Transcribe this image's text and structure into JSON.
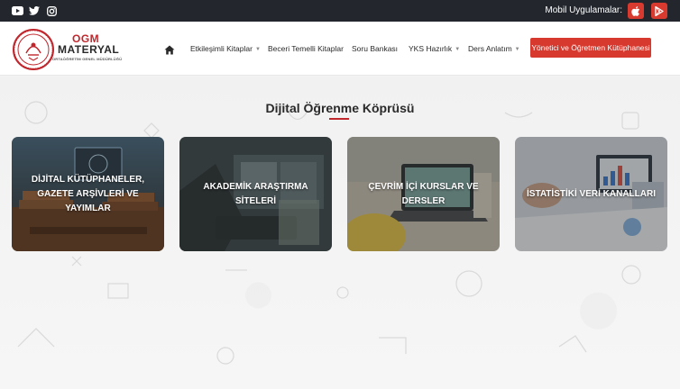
{
  "topbar": {
    "social": [
      "youtube-icon",
      "twitter-icon",
      "instagram-icon"
    ],
    "mobile_label": "Mobil Uygulamalar:",
    "apps": [
      "apple-icon",
      "google-play-icon"
    ]
  },
  "logo": {
    "line1": "OGM",
    "line2": "MATERYAL",
    "subtitle": "ORTAÖĞRETİM GENEL MÜDÜRLÜĞÜ"
  },
  "nav": {
    "home_icon": "home-icon",
    "items": [
      {
        "label": "Etkileşimli Kitaplar",
        "dropdown": true
      },
      {
        "label": "Beceri Temelli Kitaplar",
        "dropdown": false
      },
      {
        "label": "Soru Bankası",
        "dropdown": false
      },
      {
        "label": "YKS Hazırlık",
        "dropdown": true
      },
      {
        "label": "Ders Anlatım",
        "dropdown": true
      }
    ],
    "cta": "Yönetici ve Öğretmen Kütüphanesi"
  },
  "section": {
    "title": "Dijital Öğrenme Köprüsü"
  },
  "cards": [
    {
      "label": "DİJİTAL KÜTÜPHANELER, GAZETE ARŞİVLERİ VE YAYIMLAR"
    },
    {
      "label": "AKADEMİK ARAŞTIRMA SİTELERİ"
    },
    {
      "label": "ÇEVRİM İÇİ KURSLAR VE DERSLER"
    },
    {
      "label": "İSTATİSTİKİ VERİ KANALLARI"
    }
  ],
  "colors": {
    "topbar": "#23272d",
    "brand_red": "#d8392e",
    "text": "#2a2a2a"
  }
}
